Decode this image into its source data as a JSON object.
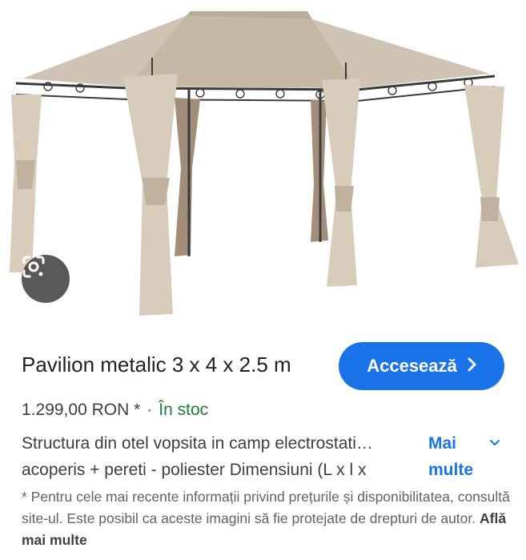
{
  "product": {
    "image_alt": "gazebo-photo",
    "title": "Pavilion metalic 3 x 4 x 2.5 m",
    "visit_label": "Accesează",
    "price": "1.299,00 RON *",
    "separator": "·",
    "stock": "În stoc",
    "description_line1": "Structura din otel vopsita in camp electrostati…",
    "description_line2": "acoperis + pereti - poliester Dimensiuni (L x l x",
    "more_label_line1": "Mai",
    "more_label_line2": "multe",
    "disclaimer": "* Pentru cele mai recente informații privind prețurile și disponibilitatea, consultă site-ul. Este posibil ca aceste imagini să fie protejate de drepturi de autor.",
    "learn_more": "Află mai multe"
  },
  "colors": {
    "accent": "#1a73e8",
    "in_stock": "#188038",
    "canopy": "#cfc4b3",
    "curtain": "#d8ccbb",
    "curtain_dark": "#a28e78",
    "frame": "#3a3a3a"
  },
  "icons": {
    "lens": "google-lens-icon",
    "visit_chevron": "chevron-right-icon",
    "more_chevron": "chevron-down-icon"
  }
}
